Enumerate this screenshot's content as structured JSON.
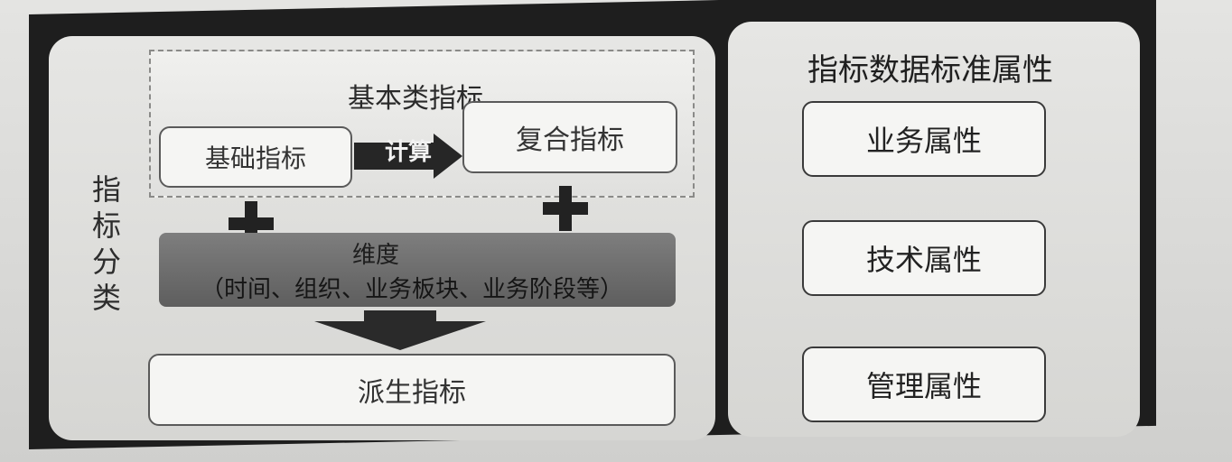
{
  "left": {
    "group_title": "基本类指标",
    "basic": "基础指标",
    "calc": "计算",
    "composite": "复合指标",
    "side_label": [
      "指",
      "标",
      "分",
      "类"
    ],
    "dimension_title": "维度",
    "dimension_sub": "（时间、组织、业务板块、业务阶段等）",
    "derived": "派生指标"
  },
  "right": {
    "title": "指标数据标准属性",
    "attributes": [
      "业务属性",
      "技术属性",
      "管理属性"
    ]
  }
}
